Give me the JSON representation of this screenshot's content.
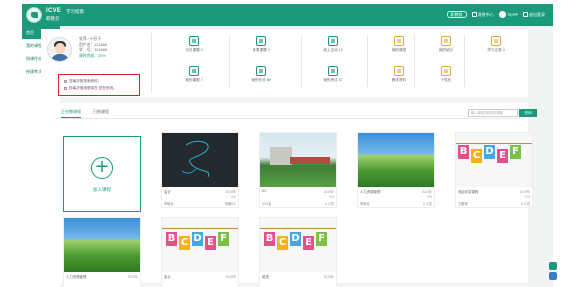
{
  "header": {
    "brand": "ICVE",
    "brand_tag": "学习指南",
    "brand_sub": "职教云",
    "pill": "职教版",
    "messages": "消息中心",
    "user": "Spark",
    "exit": "退出登录"
  },
  "sidebar": {
    "items": [
      {
        "label": "首页",
        "active": true
      },
      {
        "label": "我的课程",
        "active": false
      },
      {
        "label": "授课作业",
        "active": false
      },
      {
        "label": "授课考试",
        "active": false
      }
    ]
  },
  "profile": {
    "name": "张萍 / 小芬子",
    "account_label": "用户名：",
    "account": "121666",
    "id_label": "学　号：",
    "id": "121666",
    "progress_label": "课时完成：",
    "progress": "20%",
    "notes": [
      "您每次登录系统时。",
      "您每次使用登录在 您在系统。"
    ]
  },
  "stats": [
    {
      "label": "今日课题",
      "value": "0",
      "icon": "calendar-icon",
      "color": "#1a9a7a"
    },
    {
      "label": "本周课题",
      "value": "4",
      "icon": "seven-icon",
      "color": "#1a9a7a"
    },
    {
      "label": "线上互动",
      "value": "12",
      "icon": "chat-icon",
      "color": "#1a9a7a"
    },
    {
      "label": "我的课堂",
      "value": "",
      "icon": "person-icon",
      "color": "#e8a53b"
    },
    {
      "label": "我的统计",
      "value": "",
      "icon": "chart-icon",
      "color": "#e8a53b"
    },
    {
      "label": "学习记录",
      "value": "0",
      "icon": "book-icon",
      "color": "#e8a53b"
    },
    {
      "label": "我的课程",
      "value": "7",
      "icon": "doc-icon",
      "color": "#1a9a7a"
    },
    {
      "label": "我的作业",
      "value": "89",
      "icon": "pen-icon",
      "color": "#1a9a7a"
    },
    {
      "label": "我的考试",
      "value": "57",
      "icon": "list-icon",
      "color": "#1a9a7a"
    },
    {
      "label": "教学资料",
      "value": "",
      "icon": "folder-icon",
      "color": "#e8a53b"
    },
    {
      "label": "个性化",
      "value": "",
      "icon": "shield-icon",
      "color": "#e8a53b"
    }
  ],
  "courses": {
    "tabs": [
      "正在教课程",
      "已授课程"
    ],
    "search_placeholder": "输入课程名称查询课程",
    "search_button": "查询",
    "add_label": "加入课程",
    "cards": [
      {
        "title": "会计",
        "date": "2019年",
        "progress": "0%",
        "teacher": "李继兵",
        "count": "授课0人",
        "thumb": "dark"
      },
      {
        "title": "SC",
        "date": "2019年",
        "progress": "0%",
        "teacher": "0/74名",
        "count": "0 人员",
        "thumb": "campus"
      },
      {
        "title": "人力资源管理",
        "date": "2020年",
        "progress": "0%",
        "teacher": "李继兵",
        "count": "2 人员",
        "thumb": "grass"
      },
      {
        "title": "电影欣赏课程",
        "date": "2019年",
        "progress": "0%",
        "teacher": "王鹏程",
        "count": "0 人员",
        "thumb": "letters"
      },
      {
        "title": "人力资源管理",
        "date": "2020年",
        "progress": "",
        "teacher": "",
        "count": "",
        "thumb": "grass"
      },
      {
        "title": "会计",
        "date": "2019年",
        "progress": "",
        "teacher": "",
        "count": "",
        "thumb": "letters"
      },
      {
        "title": "英语",
        "date": "2019年",
        "progress": "",
        "teacher": "",
        "count": "",
        "thumb": "letters"
      }
    ]
  }
}
